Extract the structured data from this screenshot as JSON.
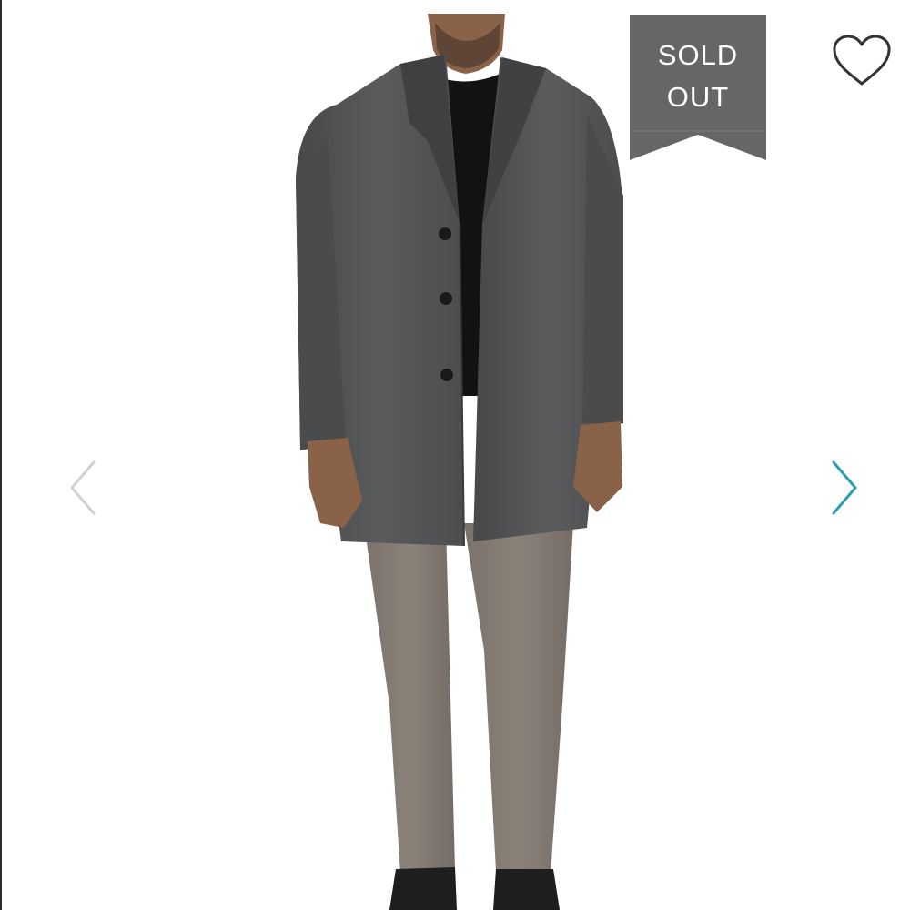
{
  "product_image": {
    "alt": "",
    "background": "#ffffff"
  },
  "badge": {
    "line1": "SOLD",
    "line2": "OUT",
    "color": "#666666"
  },
  "carousel": {
    "prev_icon": "chevron-left-icon",
    "next_icon": "chevron-right-icon",
    "prev_color": "#cfd3d6",
    "next_color": "#2a9db3"
  },
  "favorite": {
    "icon": "heart-outline-icon"
  }
}
